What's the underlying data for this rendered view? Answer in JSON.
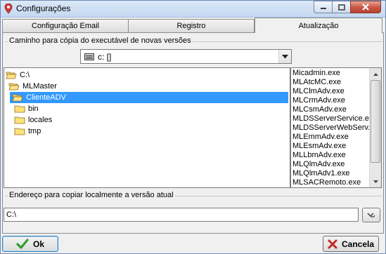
{
  "window": {
    "title": "Configurações"
  },
  "tabs": [
    {
      "label": "Configuração Email",
      "active": false
    },
    {
      "label": "Registro",
      "active": false
    },
    {
      "label": "Atualização",
      "active": true
    }
  ],
  "copy_path_group": {
    "label": "Caminho para cópia do executável de novas versões",
    "drive": {
      "selected": "c: []"
    },
    "tree": [
      {
        "label": "C:\\",
        "open": true
      },
      {
        "label": "MLMaster",
        "open": true
      },
      {
        "label": "ClienteADV",
        "open": true,
        "selected": true
      },
      {
        "label": "bin",
        "open": false
      },
      {
        "label": "locales",
        "open": false
      },
      {
        "label": "tmp",
        "open": false
      }
    ],
    "files": [
      "Micadmin.exe",
      "MLAtcMC.exe",
      "MLClmAdv.exe",
      "MLCrmAdv.exe",
      "MLCsmAdv.exe",
      "MLDSServerService.exe",
      "MLDSServerWebServ.exe",
      "MLEmmAdv.exe",
      "MLEsmAdv.exe",
      "MLLbmAdv.exe",
      "MLQlmAdv.exe",
      "MLQlmAdv1.exe",
      "MLSACRemoto.exe"
    ]
  },
  "local_copy_group": {
    "label": "Endereço para copiar localmente a versão atual",
    "path_value": "C:\\"
  },
  "buttons": {
    "ok": "Ok",
    "cancel": "Cancela"
  },
  "colors": {
    "selection": "#3399ff",
    "ok_check": "#2e9e2e",
    "cancel_x": "#c62828",
    "close_button": "#c75544"
  }
}
